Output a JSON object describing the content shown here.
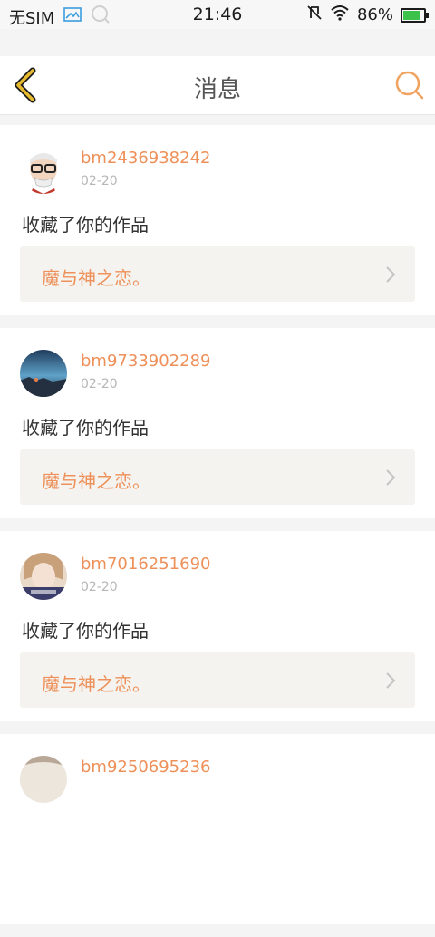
{
  "status_bar": {
    "carrier": "无SIM",
    "time": "21:46",
    "battery_percent": "86%",
    "battery_level": 0.86,
    "icons": [
      "gallery-icon",
      "search-icon",
      "mute-icon",
      "wifi-icon",
      "battery-icon"
    ]
  },
  "nav": {
    "title": "消息",
    "back_icon": "back-chevron-icon",
    "search_icon": "search-icon"
  },
  "colors": {
    "accent": "#ee9059",
    "back_stroke": "#e6b92e"
  },
  "messages": [
    {
      "username": "bm2436938242",
      "date": "02-20",
      "action": "收藏了你的作品",
      "work_title": "魔与神之恋。"
    },
    {
      "username": "bm9733902289",
      "date": "02-20",
      "action": "收藏了你的作品",
      "work_title": "魔与神之恋。"
    },
    {
      "username": "bm7016251690",
      "date": "02-20",
      "action": "收藏了你的作品",
      "work_title": "魔与神之恋。"
    },
    {
      "username": "bm9250695236",
      "date": "",
      "action": "",
      "work_title": ""
    }
  ]
}
